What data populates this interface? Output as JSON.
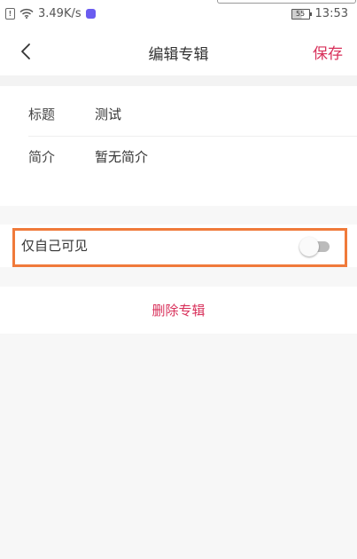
{
  "status_bar": {
    "notification_glyph": "!",
    "network_speed": "3.49K/s",
    "battery_level": "55",
    "time": "13:53"
  },
  "nav": {
    "title": "编辑专辑",
    "save_label": "保存"
  },
  "album": {
    "rows": [
      {
        "label": "标题",
        "value": "测试"
      },
      {
        "label": "简介",
        "value": "暂无简介"
      }
    ]
  },
  "privacy": {
    "label": "仅自己可见",
    "enabled": false
  },
  "actions": {
    "delete_label": "删除专辑"
  },
  "colors": {
    "accent": "#d8305a",
    "highlight": "#f07a3a"
  }
}
